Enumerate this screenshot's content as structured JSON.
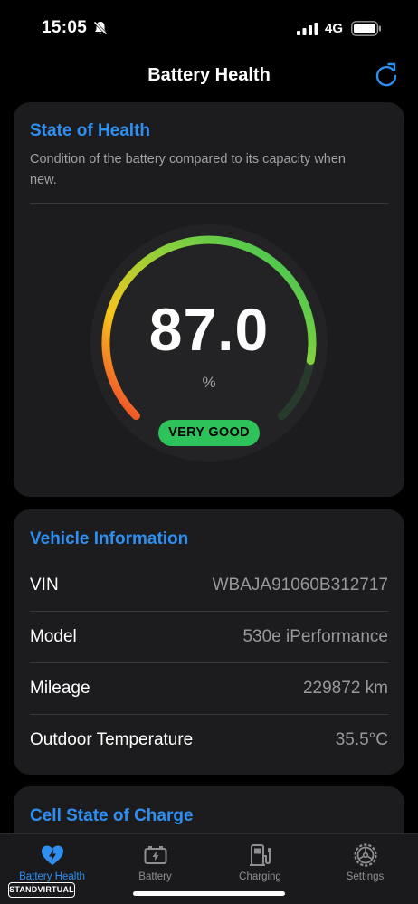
{
  "status_bar": {
    "time": "15:05",
    "network": "4G"
  },
  "header": {
    "title": "Battery Health"
  },
  "state_of_health": {
    "title": "State of Health",
    "description": "Condition of the battery compared to its capacity when new.",
    "value": "87.0",
    "unit": "%",
    "percent": 87.0,
    "badge": "VERY GOOD",
    "colors": {
      "accent": "#2f8ff0",
      "badge": "#2ec35a",
      "gauge_low": "#ee3b2c",
      "gauge_mid": "#f7c51c",
      "gauge_high": "#2ec35a"
    }
  },
  "vehicle_info": {
    "title": "Vehicle Information",
    "rows": [
      {
        "label": "VIN",
        "value": "WBAJA91060B312717"
      },
      {
        "label": "Model",
        "value": "530e iPerformance"
      },
      {
        "label": "Mileage",
        "value": "229872 km"
      },
      {
        "label": "Outdoor Temperature",
        "value": "35.5°C"
      }
    ]
  },
  "cell_state": {
    "title": "Cell State of Charge"
  },
  "tab_bar": {
    "tabs": [
      {
        "label": "Battery Health",
        "icon": "heart-bolt-icon",
        "active": true
      },
      {
        "label": "Battery",
        "icon": "battery-icon",
        "active": false
      },
      {
        "label": "Charging",
        "icon": "charging-station-icon",
        "active": false
      },
      {
        "label": "Settings",
        "icon": "gear-icon",
        "active": false
      }
    ]
  },
  "watermark": {
    "text": "STANDVIRTUAL"
  }
}
